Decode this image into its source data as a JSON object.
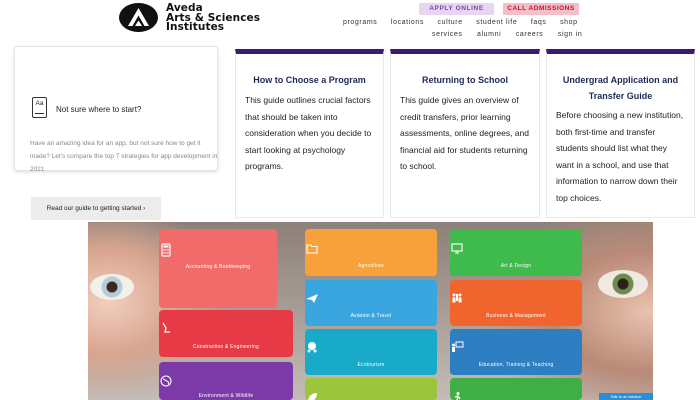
{
  "header": {
    "logo_text": [
      "Aveda",
      "Arts & Sciences",
      "Institutes"
    ],
    "apply_label": "APPLY ONLINE",
    "call_label": "CALL ADMISSIONS",
    "nav_row1": [
      "programs",
      "locations",
      "culture",
      "student life",
      "faqs",
      "shop"
    ],
    "nav_row2": [
      "services",
      "alumni",
      "careers",
      "sign in"
    ]
  },
  "intro": {
    "icon_text": "Aa",
    "title": "Not sure where to start?",
    "text": "Have an amazing idea for an app, but not sure how to get it made? Let's compare the top 7 strategies for app development in 2021",
    "button_label": "Read our guide to getting started ›"
  },
  "guides": [
    {
      "title": "How to Choose a Program",
      "body": "This guide outlines crucial factors that should be taken into consideration when you decide to start looking at psychology programs."
    },
    {
      "title": "Returning to School",
      "body": "This guide gives an overview of credit transfers, prior learning assessments, online degrees, and financial aid for students returning to school."
    },
    {
      "title": "Undergrad Application and Transfer Guide",
      "body": "Before choosing a new institution, both first-time and transfer students should list what they want in a school, and use that information to narrow down their top choices."
    }
  ],
  "tiles": [
    {
      "label": "Accounting & Bookkeeping",
      "icon": "calculator-icon",
      "color": "#f26b6b"
    },
    {
      "label": "Agriculture",
      "icon": "folder-icon",
      "color": "#f6a13a"
    },
    {
      "label": "Art & Design",
      "icon": "monitor-icon",
      "color": "#3fba4c"
    },
    {
      "label": "Aviation & Travel",
      "icon": "airplane-icon",
      "color": "#3aa6df"
    },
    {
      "label": "Business & Management",
      "icon": "team-icon",
      "color": "#f0652e"
    },
    {
      "label": "Construction & Engineering",
      "icon": "hand-tool-icon",
      "color": "#e63a46"
    },
    {
      "label": "Ecotourism",
      "icon": "globe-people-icon",
      "color": "#19a9c9"
    },
    {
      "label": "Education, Training & Teaching",
      "icon": "teacher-icon",
      "color": "#2d7fc1"
    },
    {
      "label": "Environment & Wildlife",
      "icon": "earth-icon",
      "color": "#7c3aa8"
    },
    {
      "label": "",
      "icon": "leaf-icon",
      "color": "#9bc53d"
    },
    {
      "label": "",
      "icon": "runner-icon",
      "color": "#3fae45"
    }
  ],
  "chat_badge": "Talk to an advisor",
  "colors": {
    "brand_purple": "#3c1a74",
    "apply_bg": "#e6d6f2",
    "call_bg": "#f3bfc9",
    "title_navy": "#1e2a55"
  }
}
